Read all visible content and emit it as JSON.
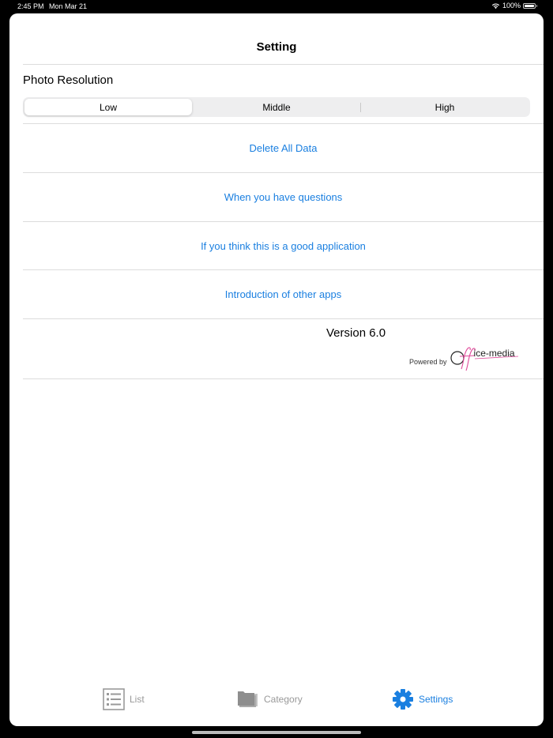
{
  "status_bar": {
    "time": "2:45 PM",
    "date": "Mon Mar 21",
    "battery": "100%",
    "battery_level": 1.0,
    "icons": [
      "wifi-icon",
      "battery-icon"
    ]
  },
  "nav": {
    "title": "Setting"
  },
  "photo_resolution": {
    "label": "Photo Resolution",
    "options": [
      "Low",
      "Middle",
      "High"
    ],
    "selected": "Low"
  },
  "actions": [
    {
      "label": "Delete All Data"
    },
    {
      "label": "When you have questions"
    },
    {
      "label": "If you think this is a good application"
    },
    {
      "label": "Introduction of other apps"
    }
  ],
  "footer": {
    "version": "Version 6.0",
    "powered_by": "Powered by",
    "logo_text": "ice-media"
  },
  "tabs": [
    {
      "label": "List",
      "icon": "list-icon",
      "active": false
    },
    {
      "label": "Category",
      "icon": "folder-stack-icon",
      "active": false
    },
    {
      "label": "Settings",
      "icon": "gear-icon",
      "active": true
    }
  ],
  "colors": {
    "accent": "#1a7fe0",
    "inactive": "#999999",
    "logo_pink": "#e0489a"
  }
}
